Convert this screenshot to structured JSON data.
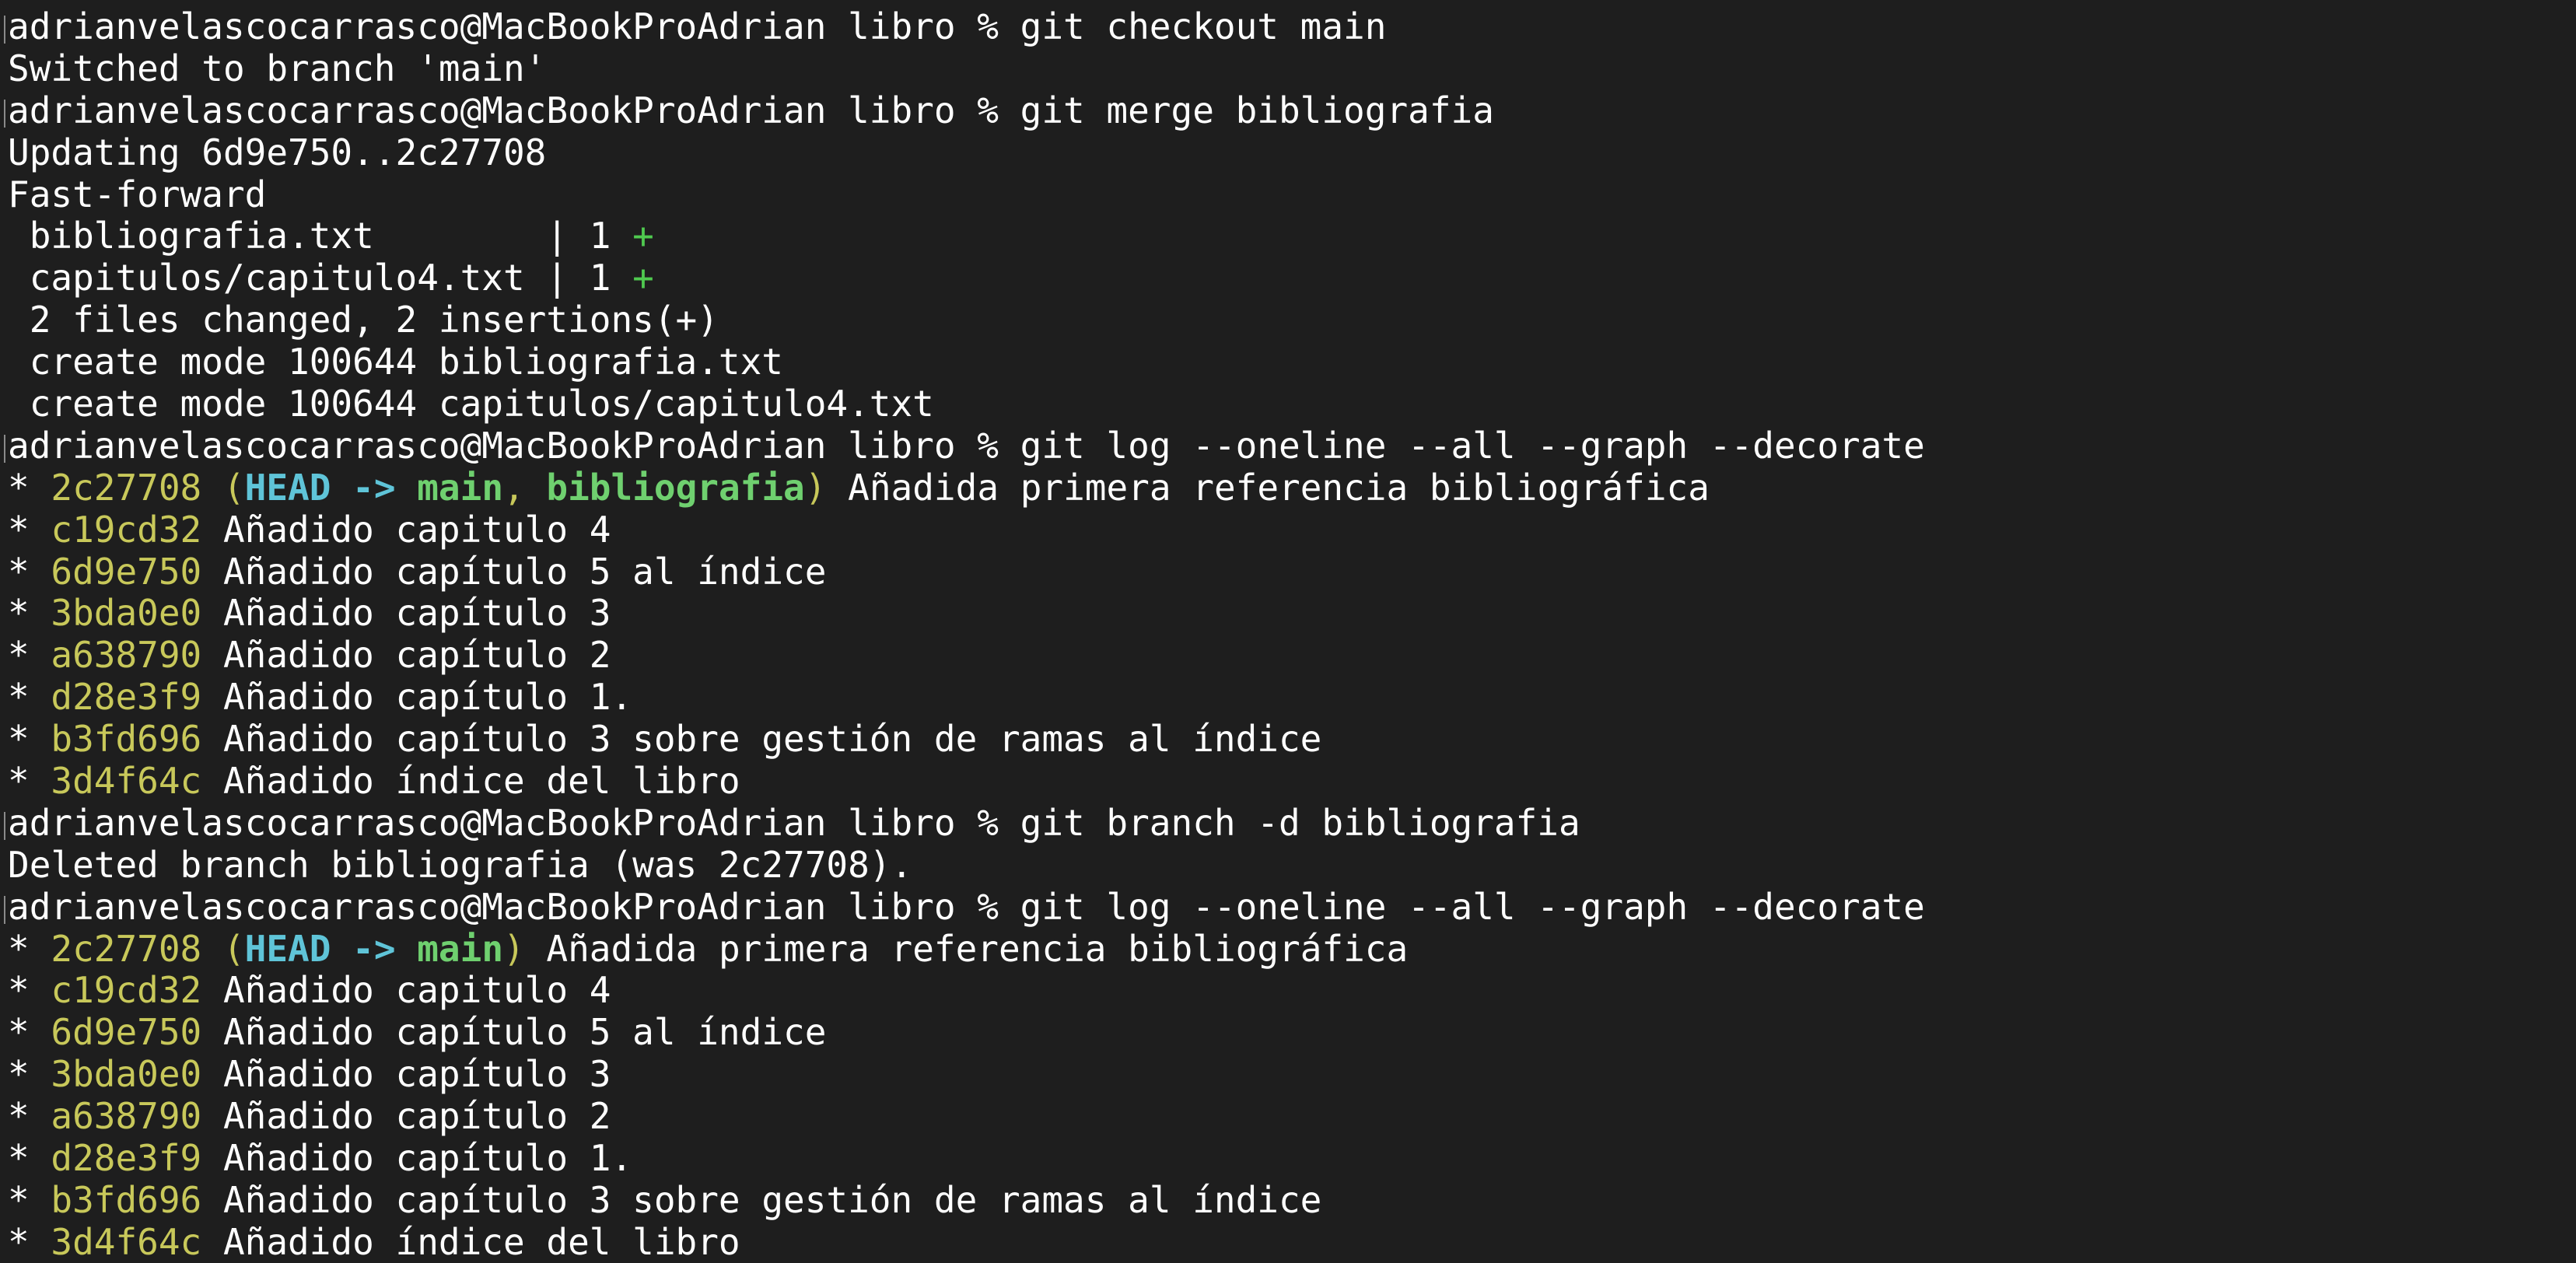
{
  "terminal": {
    "prompt": "adrianvelascocarrasco@MacBookProAdrian libro % ",
    "commands": {
      "checkout": "git checkout main",
      "merge": "git merge bibliografia",
      "log": "git log --oneline --all --graph --decorate",
      "branch_delete": "git branch -d bibliografia"
    },
    "output": {
      "switched": "Switched to branch 'main'",
      "updating": "Updating 6d9e750..2c27708",
      "fast_forward": "Fast-forward",
      "diffstat": [
        {
          "file": " bibliografia.txt        | 1 ",
          "plus": "+"
        },
        {
          "file": " capitulos/capitulo4.txt | 1 ",
          "plus": "+"
        }
      ],
      "summary": " 2 files changed, 2 insertions(+)",
      "create1": " create mode 100644 bibliografia.txt",
      "create2": " create mode 100644 capitulos/capitulo4.txt",
      "deleted": "Deleted branch bibliografia (was 2c27708)."
    },
    "log1": {
      "head_commit": {
        "hash": "2c27708",
        "head": "HEAD",
        "arrow": "->",
        "main": "main",
        "sep": ", ",
        "branch": "bibliografia",
        "message": " Añadida primera referencia bibliográfica"
      },
      "commits": [
        {
          "hash": "c19cd32",
          "message": " Añadido capitulo 4"
        },
        {
          "hash": "6d9e750",
          "message": " Añadido capítulo 5 al índice"
        },
        {
          "hash": "3bda0e0",
          "message": " Añadido capítulo 3"
        },
        {
          "hash": "a638790",
          "message": " Añadido capítulo 2"
        },
        {
          "hash": "d28e3f9",
          "message": " Añadido capítulo 1."
        },
        {
          "hash": "b3fd696",
          "message": " Añadido capítulo 3 sobre gestión de ramas al índice"
        },
        {
          "hash": "3d4f64c",
          "message": " Añadido índice del libro"
        }
      ]
    },
    "log2": {
      "head_commit": {
        "hash": "2c27708",
        "head": "HEAD",
        "arrow": "->",
        "main": "main",
        "message": " Añadida primera referencia bibliográfica"
      },
      "commits": [
        {
          "hash": "c19cd32",
          "message": " Añadido capitulo 4"
        },
        {
          "hash": "6d9e750",
          "message": " Añadido capítulo 5 al índice"
        },
        {
          "hash": "3bda0e0",
          "message": " Añadido capítulo 3"
        },
        {
          "hash": "a638790",
          "message": " Añadido capítulo 2"
        },
        {
          "hash": "d28e3f9",
          "message": " Añadido capítulo 1."
        },
        {
          "hash": "b3fd696",
          "message": " Añadido capítulo 3 sobre gestión de ramas al índice"
        },
        {
          "hash": "3d4f64c",
          "message": " Añadido índice del libro"
        }
      ]
    },
    "graph_star": "* ",
    "colors": {
      "background": "#1e1e1e",
      "foreground": "#ffffff",
      "hash": "#c8c85a",
      "head": "#5fc4d8",
      "branch": "#6fd06f",
      "plus": "#4fc94f"
    }
  }
}
